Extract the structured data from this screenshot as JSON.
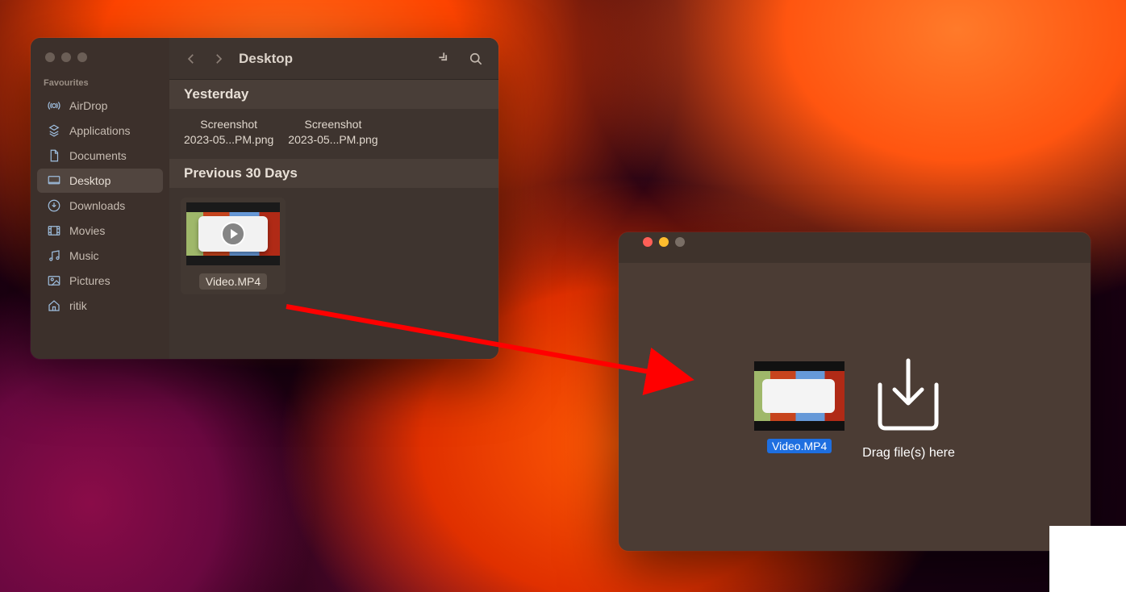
{
  "finder": {
    "title": "Desktop",
    "sidebar": {
      "section_label": "Favourites",
      "items": [
        {
          "icon": "airdrop",
          "label": "AirDrop"
        },
        {
          "icon": "apps",
          "label": "Applications"
        },
        {
          "icon": "doc",
          "label": "Documents"
        },
        {
          "icon": "desktop",
          "label": "Desktop"
        },
        {
          "icon": "download",
          "label": "Downloads"
        },
        {
          "icon": "movies",
          "label": "Movies"
        },
        {
          "icon": "music",
          "label": "Music"
        },
        {
          "icon": "pictures",
          "label": "Pictures"
        },
        {
          "icon": "home",
          "label": "ritik"
        }
      ],
      "active_index": 3
    },
    "groups": {
      "yesterday": {
        "header": "Yesterday",
        "files": [
          {
            "line1": "Screenshot",
            "line2": "2023-05...PM.png"
          },
          {
            "line1": "Screenshot",
            "line2": "2023-05...PM.png"
          }
        ]
      },
      "previous30": {
        "header": "Previous 30 Days",
        "video_label": "Video.MP4"
      }
    }
  },
  "drop": {
    "dragged_file_label": "Video.MP4",
    "drop_hint": "Drag file(s) here"
  },
  "colors": {
    "arrow": "#ff0000",
    "selection": "#1e6fe0"
  }
}
